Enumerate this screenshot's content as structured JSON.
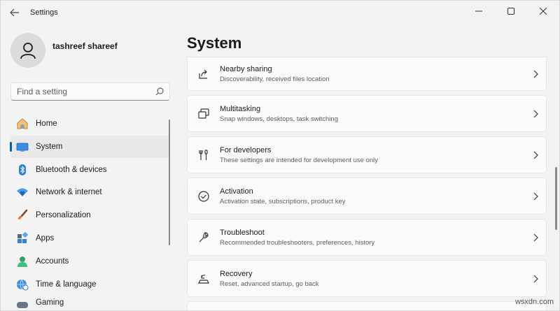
{
  "window": {
    "title": "Settings"
  },
  "profile": {
    "name": "tashreef shareef"
  },
  "search": {
    "placeholder": "Find a setting"
  },
  "nav": {
    "items": [
      {
        "label": "Home",
        "icon": "home-icon",
        "active": false
      },
      {
        "label": "System",
        "icon": "system-icon",
        "active": true
      },
      {
        "label": "Bluetooth & devices",
        "icon": "bluetooth-icon",
        "active": false
      },
      {
        "label": "Network & internet",
        "icon": "wifi-icon",
        "active": false
      },
      {
        "label": "Personalization",
        "icon": "brush-icon",
        "active": false
      },
      {
        "label": "Apps",
        "icon": "apps-icon",
        "active": false
      },
      {
        "label": "Accounts",
        "icon": "accounts-icon",
        "active": false
      },
      {
        "label": "Time & language",
        "icon": "globe-clock-icon",
        "active": false
      },
      {
        "label": "Gaming",
        "icon": "gaming-icon",
        "active": false
      }
    ]
  },
  "main": {
    "title": "System",
    "cards": [
      {
        "title": "Nearby sharing",
        "desc": "Discoverability, received files location",
        "icon": "share-icon"
      },
      {
        "title": "Multitasking",
        "desc": "Snap windows, desktops, task switching",
        "icon": "multitasking-icon"
      },
      {
        "title": "For developers",
        "desc": "These settings are intended for development use only",
        "icon": "developer-tools-icon"
      },
      {
        "title": "Activation",
        "desc": "Activation state, subscriptions, product key",
        "icon": "activation-check-icon"
      },
      {
        "title": "Troubleshoot",
        "desc": "Recommended troubleshooters, preferences, history",
        "icon": "wrench-icon"
      },
      {
        "title": "Recovery",
        "desc": "Reset, advanced startup, go back",
        "icon": "recovery-icon"
      }
    ]
  },
  "watermark": "wsxdn.com",
  "colors": {
    "accent": "#005fb8",
    "background": "#f3f3f3",
    "card": "#fbfbfb"
  }
}
